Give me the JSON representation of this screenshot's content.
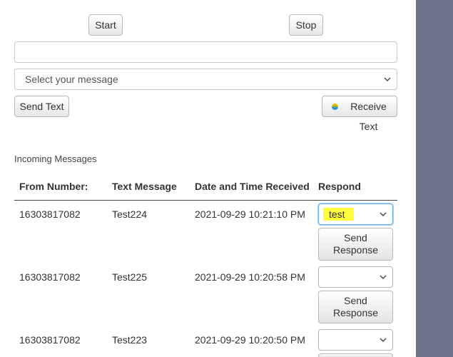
{
  "controls": {
    "start_label": "Start",
    "stop_label": "Stop",
    "text_input_value": "",
    "message_select_value": "Select your message",
    "send_text_label": "Send Text",
    "receive_text_label": "Receive Text"
  },
  "incoming": {
    "heading": "Incoming Messages",
    "columns": [
      "From Number:",
      "Text Message",
      "Date and Time Received",
      "Respond"
    ],
    "rows": [
      {
        "from": "16303817082",
        "message": "Test224",
        "received": "2021-09-29 10:21:10 PM",
        "respond_value": "test",
        "send_label_1": "Send",
        "send_label_2": "Response"
      },
      {
        "from": "16303817082",
        "message": "Test225",
        "received": "2021-09-29 10:20:58 PM",
        "respond_value": "",
        "send_label_1": "Send",
        "send_label_2": "Response"
      },
      {
        "from": "16303817082",
        "message": "Test223",
        "received": "2021-09-29 10:20:50 PM",
        "respond_value": ""
      }
    ]
  },
  "colors": {
    "gutter": "#6b7489",
    "highlight": "#ffff3c",
    "receive_icon_top": "#e8b800",
    "receive_icon_bottom": "#2e8fd8"
  }
}
